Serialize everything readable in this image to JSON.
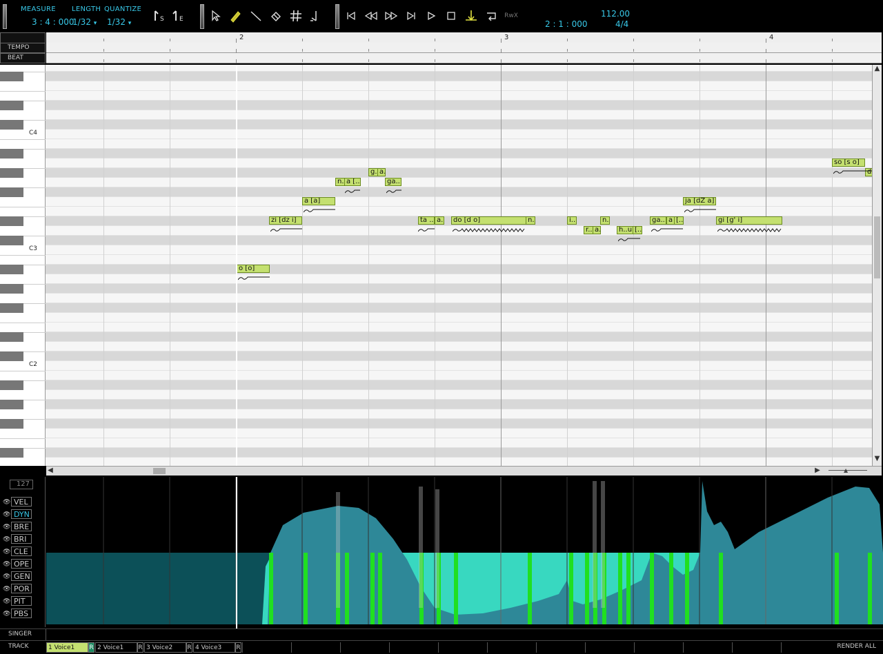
{
  "toolbar": {
    "measure_label": "MEASURE",
    "length_label": "LENGTH",
    "quantize_label": "QUANTIZE",
    "position": "3 : 4 : 000",
    "length": "1/32",
    "quantize": "1/32",
    "dropdown_glyph": "▾",
    "tools": [
      "s-start-marker",
      "e-end-marker",
      "arrow-tool",
      "pencil-tool",
      "line-tool",
      "eraser-tool",
      "grid-tool",
      "auto-tool"
    ],
    "transport": [
      "rewind-start",
      "rewind",
      "fast-forward",
      "forward-end",
      "play",
      "stop",
      "auto-scroll",
      "loop",
      "rewire"
    ],
    "counter": "2 : 1 : 000",
    "tempo": "112.00",
    "time_signature": "4/4",
    "tool_s_sub": "S",
    "tool_e_sub": "E",
    "rewire_label": "RwX"
  },
  "ruler": {
    "tempo_label": "TEMPO",
    "beat_label": "BEAT",
    "measures": [
      "2",
      "3",
      "4"
    ]
  },
  "keyboard": {
    "octave_labels": [
      "C4",
      "C3",
      "C2"
    ]
  },
  "notes": [
    {
      "lyric": "o [o]"
    },
    {
      "lyric": "zi [dz i]"
    },
    {
      "lyric": "a [a]"
    },
    {
      "lyric": "n..."
    },
    {
      "lyric": "a [..."
    },
    {
      "lyric": "g..."
    },
    {
      "lyric": "a..."
    },
    {
      "lyric": "ga..."
    },
    {
      "lyric": "ta ..."
    },
    {
      "lyric": "a.."
    },
    {
      "lyric": "do [d o]"
    },
    {
      "lyric": "n.."
    },
    {
      "lyric": "i.."
    },
    {
      "lyric": "r..."
    },
    {
      "lyric": "a.."
    },
    {
      "lyric": "n.."
    },
    {
      "lyric": "h..u"
    },
    {
      "lyric": "[..."
    },
    {
      "lyric": "ga..."
    },
    {
      "lyric": "a"
    },
    {
      "lyric": "[..."
    },
    {
      "lyric": "ja [dZ a]"
    },
    {
      "lyric": "gi [g' i]"
    },
    {
      "lyric": "so [s o]"
    },
    {
      "lyric": "d"
    }
  ],
  "control": {
    "max_value": "127",
    "params": [
      "VEL",
      "DYN",
      "BRE",
      "BRI",
      "CLE",
      "OPE",
      "GEN",
      "POR",
      "PIT",
      "PBS"
    ],
    "active_param": "DYN",
    "eye_glyph": "👁"
  },
  "bottom": {
    "singer_label": "SINGER",
    "track_label": "TRACK",
    "tracks": [
      "1 Voice1",
      "2 Voice1",
      "3 Voice2",
      "4 Voice3"
    ],
    "r_label": "R",
    "render_all": "RENDER ALL"
  },
  "colors": {
    "accent": "#38c8e8",
    "note_fill": "#c4e070",
    "dyn_fill": "#2e8898",
    "vel_fill": "#38d8c0",
    "vel_bar": "#20e020"
  }
}
